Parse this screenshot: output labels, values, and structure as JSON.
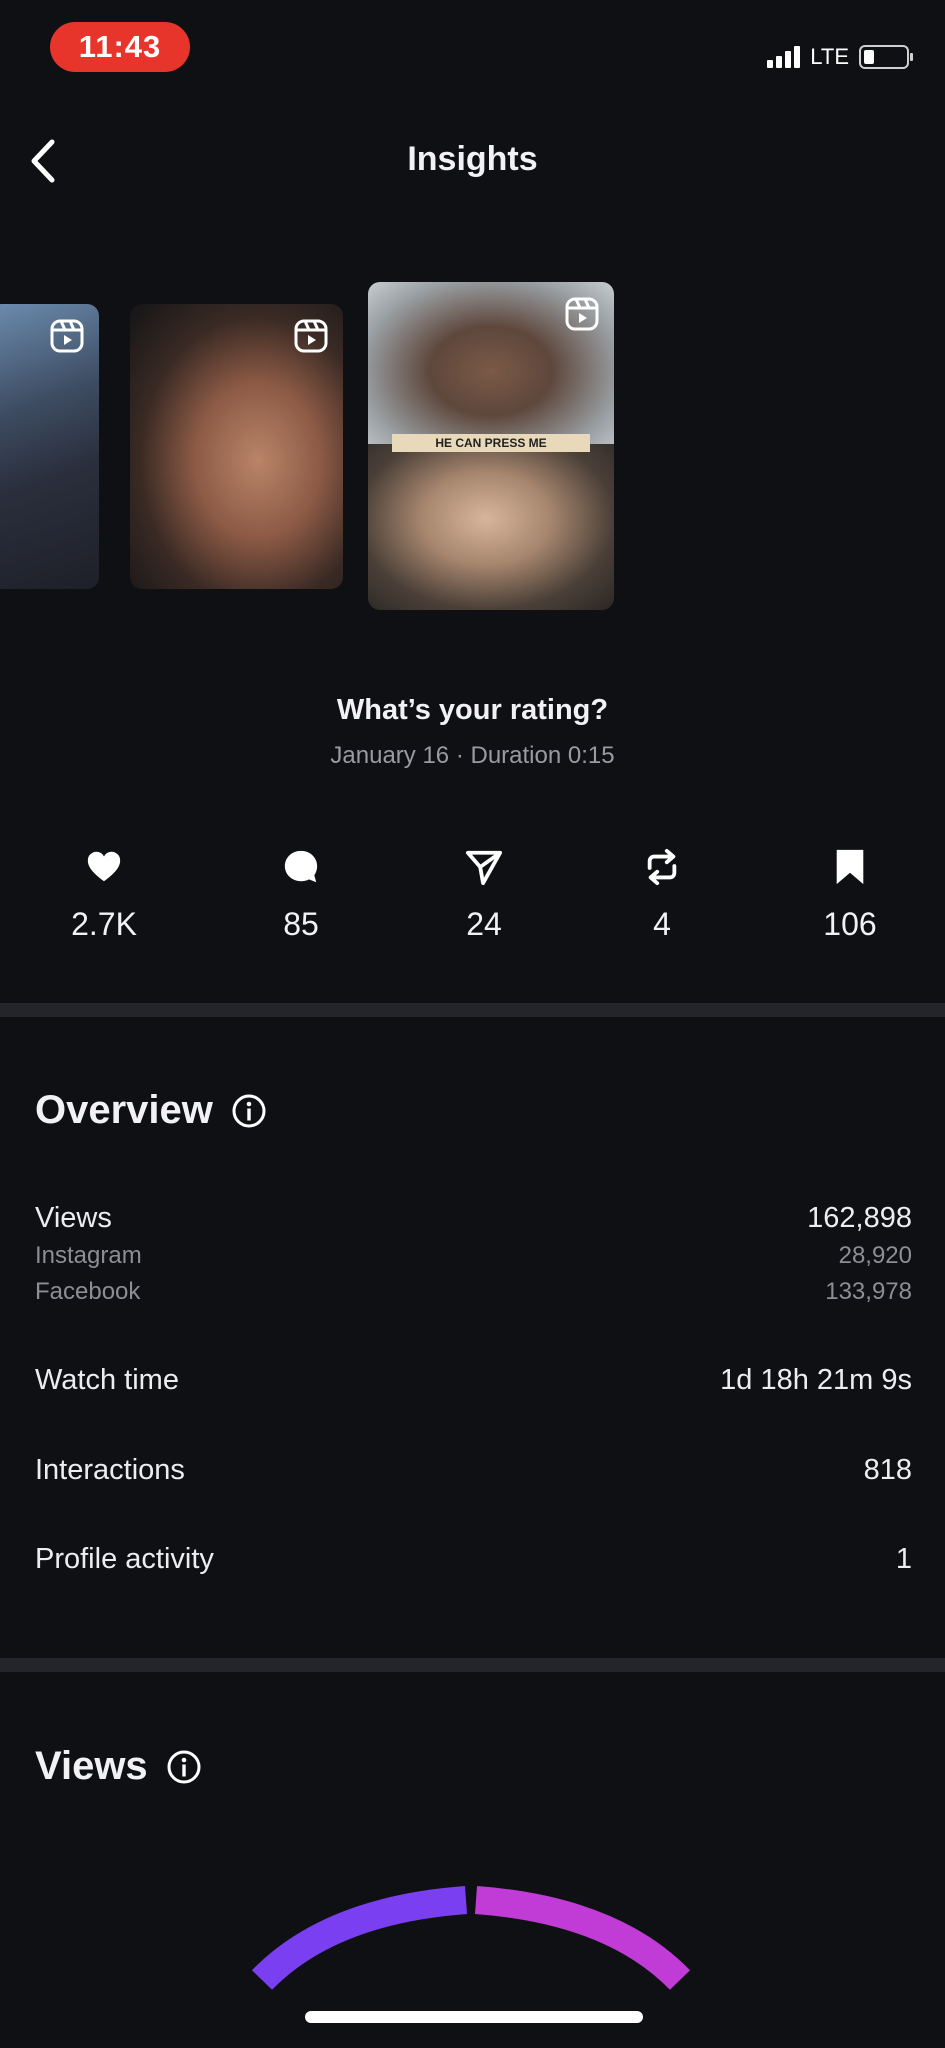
{
  "status_bar": {
    "time": "11:43",
    "network": "LTE"
  },
  "header": {
    "title": "Insights"
  },
  "reel": {
    "overlay_caption": "HE CAN PRESS ME",
    "title": "What’s your rating?",
    "meta": "January 16 · Duration 0:15"
  },
  "stats": [
    {
      "icon": "heart-icon",
      "value": "2.7K"
    },
    {
      "icon": "comment-icon",
      "value": "85"
    },
    {
      "icon": "share-icon",
      "value": "24"
    },
    {
      "icon": "repost-icon",
      "value": "4"
    },
    {
      "icon": "bookmark-icon",
      "value": "106"
    }
  ],
  "overview": {
    "title": "Overview",
    "views_label": "Views",
    "views_value": "162,898",
    "instagram_label": "Instagram",
    "instagram_value": "28,920",
    "facebook_label": "Facebook",
    "facebook_value": "133,978",
    "watch_time_label": "Watch time",
    "watch_time_value": "1d 18h 21m 9s",
    "interactions_label": "Interactions",
    "interactions_value": "818",
    "profile_activity_label": "Profile activity",
    "profile_activity_value": "1"
  },
  "views_section": {
    "title": "Views"
  },
  "colors": {
    "background": "#0f1014",
    "time_pill": "#e8352b",
    "divider": "#24252b",
    "gauge_purple": "#7b3ff2",
    "gauge_magenta": "#c13bd6"
  }
}
